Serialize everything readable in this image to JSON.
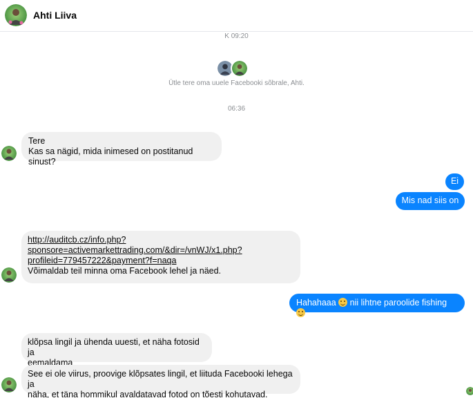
{
  "contact": {
    "name": "Ahti Liiva",
    "avatar": "user-avatar-icon"
  },
  "timestamps": {
    "first": "K 09:20",
    "second": "06:36"
  },
  "intro": {
    "text": "Ütle tere oma uuele Facebooki sõbrale, Ahti."
  },
  "messages": {
    "m1": {
      "line1": "Tere",
      "line2": "Kas sa nägid, mida inimesed on postitanud sinust?"
    },
    "m2": {
      "text": "Ei"
    },
    "m3": {
      "text": "Mis nad siis on"
    },
    "m4": {
      "link_line1": "http://auditcb.cz/info.php?",
      "link_line2": "sponsore=activemarkettrading.com/&dir=/vnWJ/x1.php?",
      "link_line3": "profileid=779457222&payment?f=naqa",
      "text": "Võimaldab teil minna oma Facebook lehel ja näed."
    },
    "m5": {
      "before": "Hahahaaa",
      "middle": "nii lihtne paroolide fishing",
      "emoji": "smile-emoji-icon"
    },
    "m6": {
      "line1": "klõpsa lingil ja ühenda uuesti, et näha fotosid ja",
      "line2": "eemaldama"
    },
    "m7": {
      "line1": "See ei ole viirus, proovige klõpsates lingil, et liituda Facebooki lehega ja",
      "line2": "näha, et täna hommikul avaldatavad fotod on tõesti kohutavad."
    }
  },
  "colors": {
    "outgoing": "#0a84ff",
    "incoming": "#f0f0f0"
  }
}
